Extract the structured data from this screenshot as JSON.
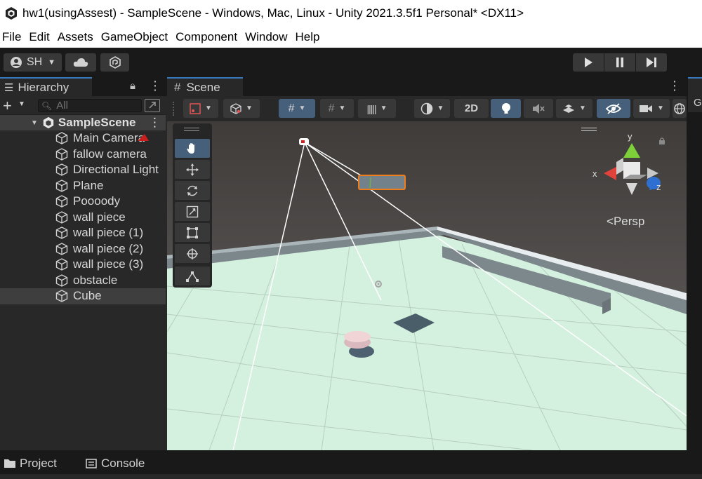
{
  "window": {
    "title": "hw1(usingAssest) - SampleScene - Windows, Mac, Linux - Unity 2021.3.5f1 Personal* <DX11>"
  },
  "menu": [
    "File",
    "Edit",
    "Assets",
    "GameObject",
    "Component",
    "Window",
    "Help"
  ],
  "toolbar": {
    "account_label": "SH",
    "icons": [
      "account-icon",
      "cloud-icon",
      "collab-icon",
      "play-icon",
      "pause-icon",
      "step-icon"
    ]
  },
  "hierarchy": {
    "tab_label": "Hierarchy",
    "search_placeholder": "All",
    "scene_name": "SampleScene",
    "objects": [
      "Main Camera",
      "fallow camera",
      "Directional Light",
      "Plane",
      "Poooody",
      "wall piece",
      "wall piece (1)",
      "wall piece (2)",
      "wall piece (3)",
      "obstacle",
      "Cube"
    ],
    "selected": "Cube"
  },
  "scene": {
    "tab_label": "Scene",
    "toggle_2d": "2D",
    "persp_label": "Persp",
    "axis_labels": {
      "x": "x",
      "y": "y",
      "z": "z"
    }
  },
  "right_tab_label": "G",
  "bottom_tabs": {
    "project": "Project",
    "console": "Console"
  },
  "colors": {
    "accent": "#3a79bb",
    "panel": "#282828",
    "ground": "#d5f1df",
    "sky": "#5a5757",
    "selection_orange": "#f07d1c"
  }
}
